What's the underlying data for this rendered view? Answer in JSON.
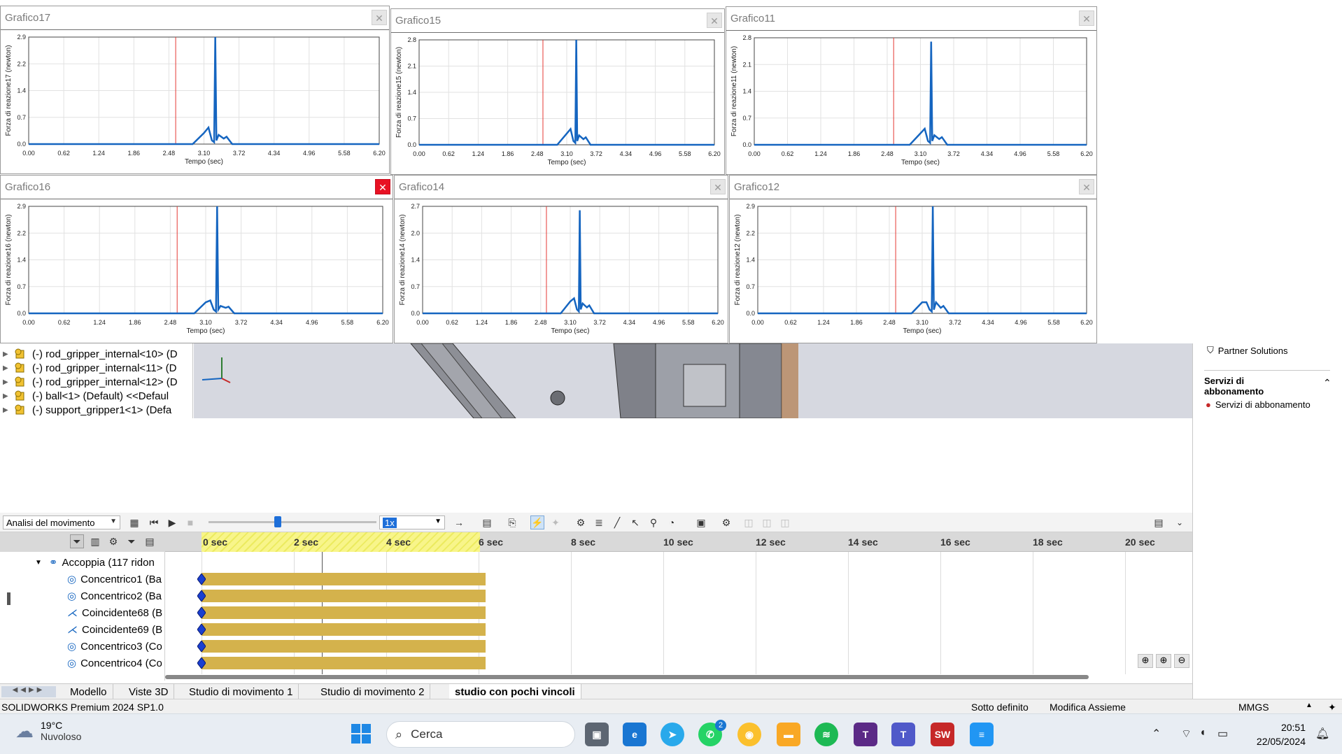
{
  "charts": [
    {
      "title": "Grafico17",
      "ylabel": "Forza di reazione17 (newton)",
      "xlabel": "Tempo (sec)",
      "yticks": [
        "2.9",
        "2.2",
        "1.4",
        "0.7",
        "0.0"
      ],
      "ymax": 2.9,
      "peak": 2.9,
      "close_active": false
    },
    {
      "title": "Grafico15",
      "ylabel": "Forza di reazione15 (newton)",
      "xlabel": "Tempo (sec)",
      "yticks": [
        "2.8",
        "2.1",
        "1.4",
        "0.7",
        "0.0"
      ],
      "ymax": 2.8,
      "peak": 2.8,
      "close_active": false
    },
    {
      "title": "Grafico11",
      "ylabel": "Forza di reazione11 (newton)",
      "xlabel": "Tempo (sec)",
      "yticks": [
        "2.8",
        "2.1",
        "1.4",
        "0.7",
        "0.0"
      ],
      "ymax": 2.8,
      "peak": 2.7,
      "close_active": false
    },
    {
      "title": "Grafico16",
      "ylabel": "Forza di reazione16 (newton)",
      "xlabel": "Tempo (sec)",
      "yticks": [
        "2.9",
        "2.2",
        "1.4",
        "0.7",
        "0.0"
      ],
      "ymax": 2.9,
      "peak": 2.9,
      "close_active": true
    },
    {
      "title": "Grafico14",
      "ylabel": "Forza di reazione14 (newton)",
      "xlabel": "Tempo (sec)",
      "yticks": [
        "2.7",
        "2.0",
        "1.4",
        "0.7",
        "0.0"
      ],
      "ymax": 2.7,
      "peak": 2.6,
      "close_active": false
    },
    {
      "title": "Grafico12",
      "ylabel": "Forza di reazione12 (newton)",
      "xlabel": "Tempo (sec)",
      "yticks": [
        "2.9",
        "2.2",
        "1.4",
        "0.7",
        "0.0"
      ],
      "ymax": 2.9,
      "peak": 2.9,
      "close_active": false
    }
  ],
  "chart_data": [
    {
      "type": "line",
      "title": "Grafico17",
      "xlabel": "Tempo (sec)",
      "ylabel": "Forza di reazione17 (newton)",
      "xlim": [
        0,
        6.2
      ],
      "ylim": [
        0,
        2.9
      ],
      "x": [
        0,
        2.9,
        3.1,
        3.18,
        3.24,
        3.28,
        3.3,
        3.32,
        3.36,
        3.45,
        3.5,
        3.6,
        6.2
      ],
      "y": [
        0,
        0,
        0.3,
        0.45,
        0.1,
        0.05,
        2.9,
        0.1,
        0.25,
        0.15,
        0.2,
        0,
        0
      ],
      "marker_x": 2.6
    },
    {
      "type": "line",
      "title": "Grafico15",
      "xlabel": "Tempo (sec)",
      "ylabel": "Forza di reazione15 (newton)",
      "xlim": [
        0,
        6.2
      ],
      "ylim": [
        0,
        2.8
      ],
      "x": [
        0,
        2.9,
        3.1,
        3.18,
        3.24,
        3.28,
        3.3,
        3.32,
        3.36,
        3.45,
        3.5,
        3.6,
        6.2
      ],
      "y": [
        0,
        0,
        0.3,
        0.42,
        0.1,
        0.05,
        2.8,
        0.1,
        0.25,
        0.15,
        0.2,
        0,
        0
      ],
      "marker_x": 2.6
    },
    {
      "type": "line",
      "title": "Grafico11",
      "xlabel": "Tempo (sec)",
      "ylabel": "Forza di reazione11 (newton)",
      "xlim": [
        0,
        6.2
      ],
      "ylim": [
        0,
        2.8
      ],
      "x": [
        0,
        2.9,
        3.1,
        3.18,
        3.24,
        3.28,
        3.3,
        3.32,
        3.36,
        3.45,
        3.5,
        3.6,
        6.2
      ],
      "y": [
        0,
        0,
        0.3,
        0.42,
        0.1,
        0.05,
        2.7,
        0.1,
        0.25,
        0.15,
        0.2,
        0,
        0
      ],
      "marker_x": 2.6
    },
    {
      "type": "line",
      "title": "Grafico16",
      "xlabel": "Tempo (sec)",
      "ylabel": "Forza di reazione16 (newton)",
      "xlim": [
        0,
        6.2
      ],
      "ylim": [
        0,
        2.9
      ],
      "x": [
        0,
        2.9,
        3.1,
        3.18,
        3.24,
        3.28,
        3.3,
        3.32,
        3.36,
        3.45,
        3.5,
        3.6,
        6.2
      ],
      "y": [
        0,
        0,
        0.3,
        0.35,
        0.1,
        0.05,
        2.9,
        0.1,
        0.2,
        0.15,
        0.18,
        0,
        0
      ],
      "marker_x": 2.6
    },
    {
      "type": "line",
      "title": "Grafico14",
      "xlabel": "Tempo (sec)",
      "ylabel": "Forza di reazione14 (newton)",
      "xlim": [
        0,
        6.2
      ],
      "ylim": [
        0,
        2.7
      ],
      "x": [
        0,
        2.9,
        3.1,
        3.18,
        3.24,
        3.28,
        3.3,
        3.32,
        3.36,
        3.45,
        3.5,
        3.6,
        6.2
      ],
      "y": [
        0,
        0,
        0.3,
        0.38,
        0.1,
        0.05,
        2.6,
        0.1,
        0.25,
        0.15,
        0.2,
        0,
        0
      ],
      "marker_x": 2.6
    },
    {
      "type": "line",
      "title": "Grafico12",
      "xlabel": "Tempo (sec)",
      "ylabel": "Forza di reazione12 (newton)",
      "xlim": [
        0,
        6.2
      ],
      "ylim": [
        0,
        2.9
      ],
      "x": [
        0,
        2.9,
        3.1,
        3.18,
        3.24,
        3.28,
        3.3,
        3.32,
        3.36,
        3.45,
        3.5,
        3.6,
        6.2
      ],
      "y": [
        0,
        0,
        0.3,
        0.3,
        0.1,
        0.05,
        2.9,
        0.1,
        0.3,
        0.15,
        0.2,
        0,
        0
      ],
      "marker_x": 2.6
    }
  ],
  "xticks": [
    "0.00",
    "0.62",
    "1.24",
    "1.86",
    "2.48",
    "3.10",
    "3.72",
    "4.34",
    "4.96",
    "5.58",
    "6.20"
  ],
  "tree": {
    "items": [
      "(-) rod_gripper_internal<10> (D",
      "(-) rod_gripper_internal<11> (D",
      "(-) rod_gripper_internal<12> (D",
      "(-) ball<1> (Default) <<Defaul",
      "(-) support_gripper1<1> (Defa"
    ]
  },
  "right_panel": {
    "partner": "Partner Solutions",
    "section_title": "Servizi di abbonamento",
    "section_item": "Servizi di abbonamento"
  },
  "motion": {
    "study_type": "Analisi del movimento",
    "speed": "1x"
  },
  "timeline": {
    "group": "Accoppia (117 ridon",
    "rows": [
      "Concentrico1 (Ba",
      "Concentrico2 (Ba",
      "Coincidente68 (B",
      "Coincidente69 (B",
      "Concentrico3 (Co",
      "Concentrico4 (Co"
    ],
    "ticks": [
      "0 sec",
      "2 sec",
      "4 sec",
      "6 sec",
      "8 sec",
      "10 sec",
      "12 sec",
      "14 sec",
      "16 sec",
      "18 sec",
      "20 sec"
    ],
    "bar_end_sec": 6
  },
  "tabs": [
    "Modello",
    "Viste 3D",
    "Studio di movimento 1",
    "Studio di movimento 2",
    "studio con pochi vincoli"
  ],
  "status": {
    "product": "SOLIDWORKS Premium 2024 SP1.0",
    "state": "Sotto definito",
    "mode": "Modifica Assieme",
    "units": "MMGS"
  },
  "taskbar": {
    "temp": "19°C",
    "weather": "Nuvoloso",
    "search": "Cerca",
    "time": "20:51",
    "date": "22/05/2024",
    "whatsapp_badge": "2"
  },
  "colors": {
    "line": "#1565c0",
    "marker": "#e53935",
    "bar": "#d4b24c",
    "highlight": "#f8f58a"
  }
}
